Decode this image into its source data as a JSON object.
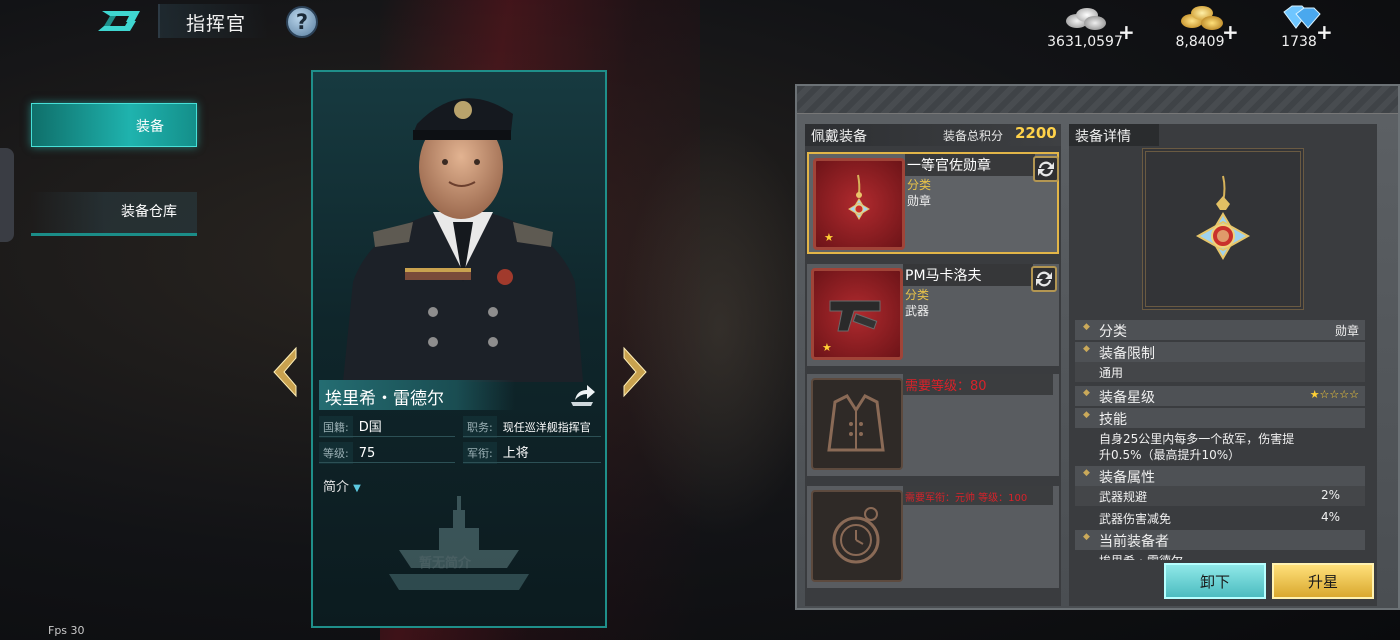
{
  "header": {
    "title": "指挥官",
    "help_label": "?",
    "currencies": [
      {
        "icon": "silver-coins-icon",
        "amount": "3631,0597",
        "plus": "+"
      },
      {
        "icon": "gold-coins-icon",
        "amount": "8,8409",
        "plus": "+"
      },
      {
        "icon": "diamond-icon",
        "amount": "1738",
        "plus": "+"
      }
    ]
  },
  "tabs": {
    "equipment": "装备",
    "warehouse": "装备仓库"
  },
  "commander": {
    "name": "埃里希・雷德尔",
    "nationality_label": "国籍:",
    "nationality": "D国",
    "position_label": "职务:",
    "position": "现任巡洋舰指挥官",
    "level_label": "等级:",
    "level": "75",
    "rank_label": "军衔:",
    "rank": "上将",
    "intro_label": "简介",
    "no_intro": "暂无简介"
  },
  "equipped": {
    "title": "佩戴装备",
    "score_label": "装备总积分",
    "score": "2200",
    "slots": [
      {
        "name": "一等官佐勋章",
        "category_label": "分类",
        "category": "勋章",
        "icon": "medal-icon"
      },
      {
        "name": "PM马卡洛夫",
        "category_label": "分类",
        "category": "武器",
        "icon": "pistol-icon"
      },
      {
        "requirement": "需要等级：80",
        "icon": "uniform-icon"
      },
      {
        "requirement": "需要军衔：元帅 等级：100",
        "icon": "pocket-watch-icon"
      }
    ]
  },
  "details": {
    "title": "装备详情",
    "category_label": "分类",
    "category_value": "勋章",
    "limit_label": "装备限制",
    "limit_value": "通用",
    "star_label": "装备星级",
    "stars": "★☆☆☆☆",
    "skill_label": "技能",
    "skill_line1": "自身25公里内每多一个敌军，伤害提",
    "skill_line2": "升0.5%（最高提升10%）",
    "attr_label": "装备属性",
    "attrs": [
      {
        "name": "武器规避",
        "value": "2%"
      },
      {
        "name": "武器伤害减免",
        "value": "4%"
      }
    ],
    "owner_label": "当前装备者",
    "owner_value": "埃里希・雷德尔"
  },
  "buttons": {
    "unload": "卸下",
    "star_up": "升星"
  },
  "fps": "Fps 30",
  "colors": {
    "accent_teal": "#1fb3ae",
    "gold": "#ffd24a",
    "requirement_red": "#d8222a"
  }
}
